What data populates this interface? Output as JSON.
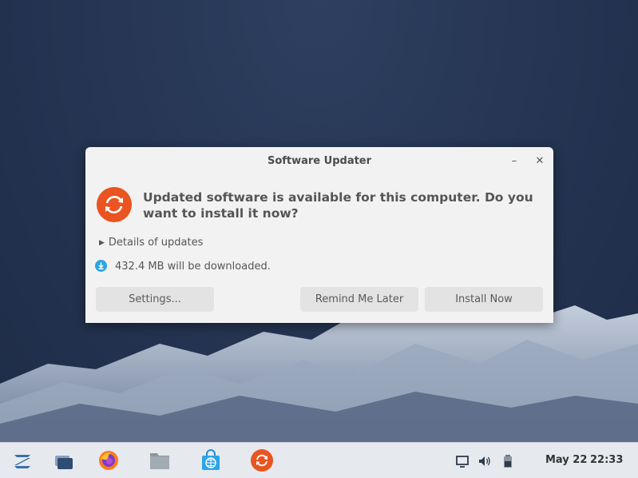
{
  "window": {
    "title": "Software Updater",
    "minimize_glyph": "–",
    "close_glyph": "✕"
  },
  "dialog": {
    "heading": "Updated software is available for this computer. Do you want to install it now?",
    "details_label": "Details of updates",
    "download_text": "432.4 MB will be downloaded.",
    "buttons": {
      "settings": "Settings...",
      "remind": "Remind Me Later",
      "install": "Install Now"
    },
    "icons": {
      "app": "software-updater-icon",
      "download": "download-icon"
    },
    "colors": {
      "accent": "#e95420",
      "download": "#2ba5e3"
    }
  },
  "taskbar": {
    "items": [
      "zorin-menu-icon",
      "show-desktop-icon",
      "firefox-icon",
      "files-icon",
      "software-store-icon",
      "software-updater-icon"
    ],
    "tray": [
      "display-icon",
      "volume-icon",
      "battery-icon"
    ],
    "date": "May 22",
    "time": "22:33"
  }
}
